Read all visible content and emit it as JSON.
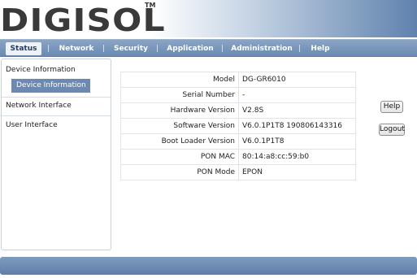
{
  "brand": {
    "logo_text": "DIGISOL",
    "trademark": "TM"
  },
  "nav": {
    "items": [
      {
        "label": "Status",
        "active": true
      },
      {
        "label": "Network"
      },
      {
        "label": "Security"
      },
      {
        "label": "Application"
      },
      {
        "label": "Administration"
      },
      {
        "label": "Help"
      }
    ],
    "separator": "|"
  },
  "sidebar": {
    "section_title": "Device Information",
    "selected_item": "Device Information",
    "items": [
      {
        "label": "Network Interface"
      },
      {
        "label": "User Interface"
      }
    ]
  },
  "device_info": {
    "rows": [
      {
        "label": "Model",
        "value": "DG-GR6010"
      },
      {
        "label": "Serial Number",
        "value": "-"
      },
      {
        "label": "Hardware Version",
        "value": "V2.8S"
      },
      {
        "label": "Software Version",
        "value": "V6.0.1P1T8 190806143316"
      },
      {
        "label": "Boot Loader Version",
        "value": "V6.0.1P1T8"
      },
      {
        "label": "PON MAC",
        "value": "80:14:a8:cc:59:b0"
      },
      {
        "label": "PON Mode",
        "value": "EPON"
      }
    ]
  },
  "buttons": {
    "help_label": "Help",
    "logout_label": "Logout"
  },
  "colors": {
    "nav_blue": "#6a8ab3",
    "active_tab_bg": "#eef2f7",
    "sidebar_selected": "#6a8ab3"
  }
}
